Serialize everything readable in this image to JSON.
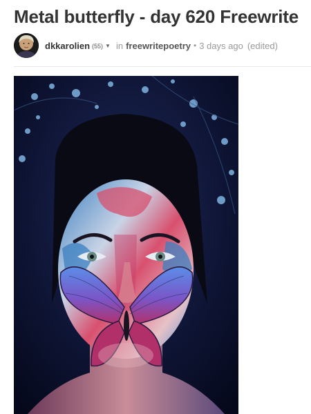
{
  "post": {
    "title": "Metal butterfly - day 620 Freewrite",
    "author": {
      "name": "dkkarolien",
      "reputation": "(55)",
      "menu_icon": "caret-down-icon"
    },
    "in_label": "in",
    "community": "freewritepoetry",
    "separator": "•",
    "time_ago": "3 days ago",
    "edited_label": "(edited)"
  },
  "image": {
    "subject": "painted-face-with-butterfly",
    "colors": {
      "background": "#0d1130",
      "paint_blue": "#3b7fc0",
      "paint_pink": "#d8506e",
      "butterfly_blue": "#5b8de8",
      "butterfly_magenta": "#b2306a",
      "flowers": "#7fb4e0"
    }
  }
}
